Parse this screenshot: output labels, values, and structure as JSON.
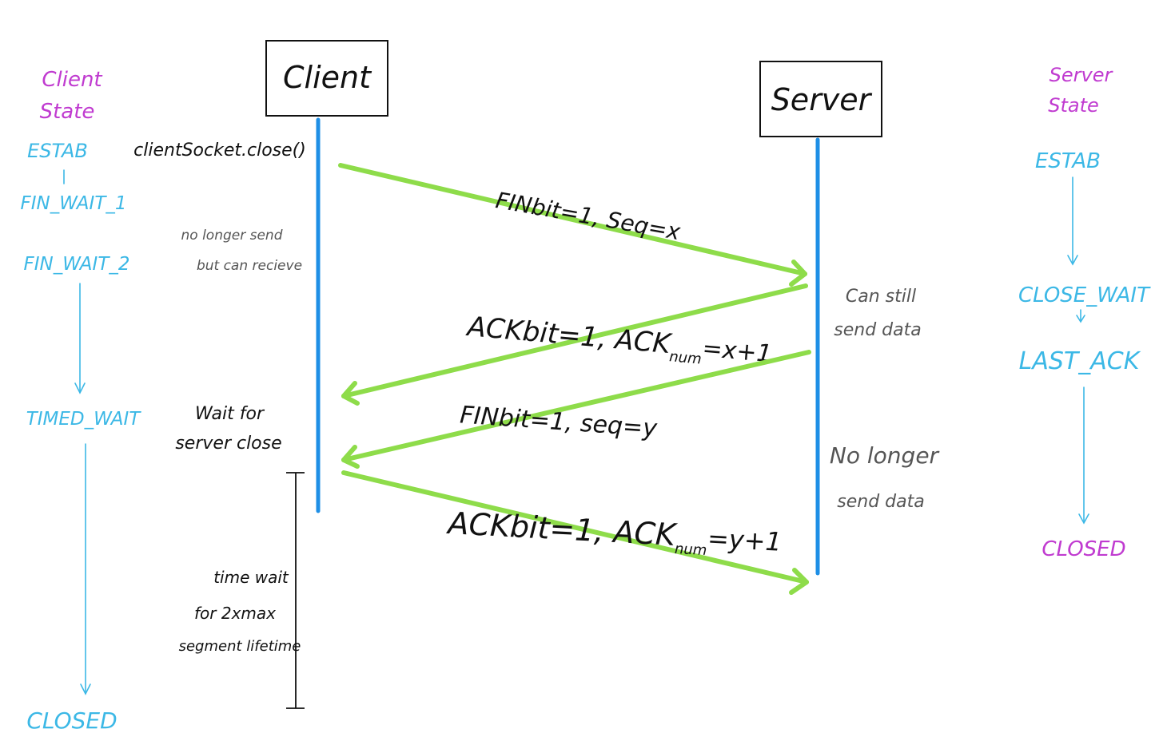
{
  "client_box": "Client",
  "server_box": "Server",
  "client_state_title": [
    "Client",
    "State"
  ],
  "server_state_title": [
    "Server",
    "State"
  ],
  "client_states": {
    "estab": "ESTAB",
    "fin_wait_1": "FIN_WAIT_1",
    "fin_wait_2": "FIN_WAIT_2",
    "timed_wait": "TIMED_WAIT",
    "closed": "CLOSED"
  },
  "server_states": {
    "estab": "ESTAB",
    "close_wait": "CLOSE_WAIT",
    "last_ack": "LAST_ACK",
    "closed": "CLOSED"
  },
  "client_call": "clientSocket.close()",
  "messages": {
    "fin1": "FINbit=1, Seq=x",
    "ack1_main": "ACKbit=1, ACK",
    "ack1_sub": "num",
    "ack1_tail": "=x+1",
    "fin2": "FINbit=1, seq=y",
    "ack2_main": "ACKbit=1, ACK",
    "ack2_sub": "num",
    "ack2_tail": "=y+1"
  },
  "notes": {
    "no_longer_send_1": "no longer send",
    "no_longer_send_2": "but can recieve",
    "wait_server_1": "Wait for",
    "wait_server_2": "server close",
    "can_still_1": "Can still",
    "can_still_2": "send data",
    "server_no_longer_1": "No longer",
    "server_no_longer_2": "send data",
    "time_wait_1": "time wait",
    "time_wait_2": "for 2xmax",
    "time_wait_3": "segment lifetime"
  },
  "colors": {
    "state_title": "#c03bd0",
    "state_label": "#3cb8e6",
    "lifeline": "#1e8fe6",
    "message_arrow": "#8edc4a"
  }
}
